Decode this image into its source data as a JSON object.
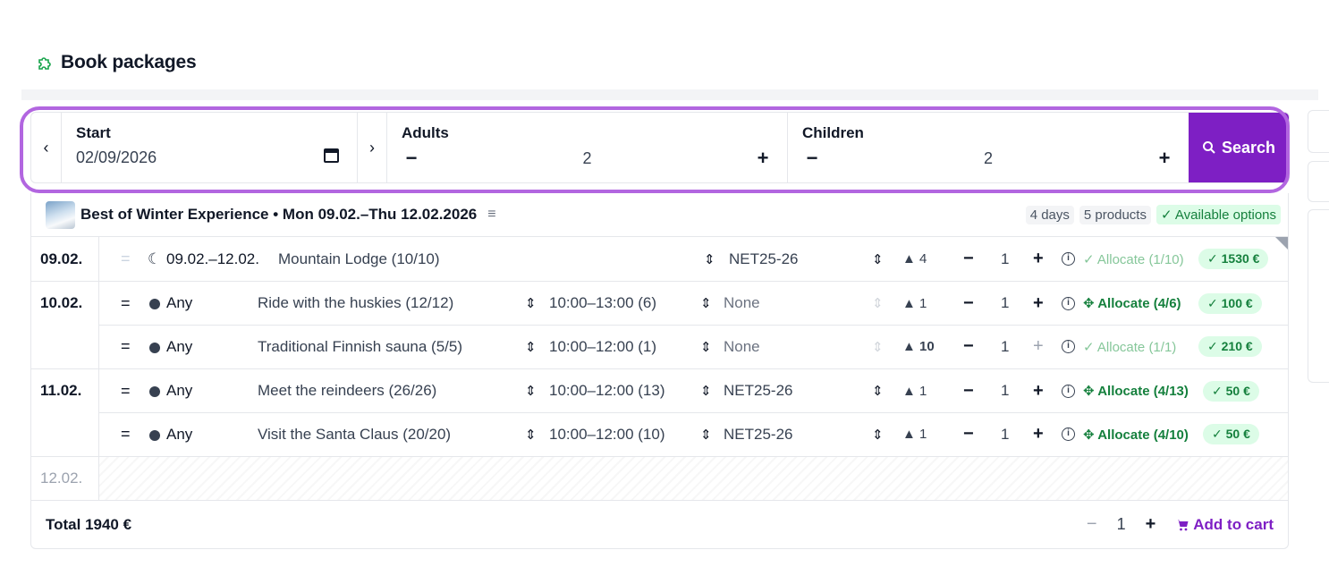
{
  "page": {
    "title": "Book packages",
    "icon": "puzzle-piece-icon"
  },
  "search": {
    "prev_label": "‹",
    "next_label": "›",
    "start": {
      "label": "Start",
      "value": "02/09/2026"
    },
    "adults": {
      "label": "Adults",
      "value": "2",
      "minus": "−",
      "plus": "+"
    },
    "children": {
      "label": "Children",
      "value": "2",
      "minus": "−",
      "plus": "+"
    },
    "button_label": "Search"
  },
  "package": {
    "title": "Best of Winter Experience • Mon 09.02.–Thu 12.02.2026",
    "days": "4 days",
    "products": "5 products",
    "available": "✓ Available options"
  },
  "days": [
    {
      "date": "09.02."
    },
    {
      "date": "10.02."
    },
    {
      "date": "11.02."
    },
    {
      "date": "12.02."
    }
  ],
  "items": [
    {
      "drag": "=",
      "time": "09.02.–12.02.",
      "name": "Mountain Lodge (10/10)",
      "slot": "",
      "option": "NET25-26",
      "persons": "4",
      "qty": "1",
      "allocate": "✓ Allocate (1/10)",
      "price": "✓ 1530 €"
    },
    {
      "drag": "=",
      "time": "Any",
      "name": "Ride with the huskies (12/12)",
      "slot": "10:00–13:00 (6)",
      "option": "None",
      "persons": "1",
      "qty": "1",
      "allocate": "Allocate (4/6)",
      "price": "✓ 100 €"
    },
    {
      "drag": "=",
      "time": "Any",
      "name": "Traditional Finnish sauna (5/5)",
      "slot": "10:00–12:00 (1)",
      "option": "None",
      "persons": "10",
      "qty": "1",
      "allocate": "✓ Allocate (1/1)",
      "price": "✓ 210 €"
    },
    {
      "drag": "=",
      "time": "Any",
      "name": "Meet the reindeers (26/26)",
      "slot": "10:00–12:00 (13)",
      "option": "NET25-26",
      "persons": "1",
      "qty": "1",
      "allocate": "Allocate (4/13)",
      "price": "✓ 50 €"
    },
    {
      "drag": "=",
      "time": "Any",
      "name": "Visit the Santa Claus (20/20)",
      "slot": "10:00–12:00 (10)",
      "option": "NET25-26",
      "persons": "1",
      "qty": "1",
      "allocate": "Allocate (4/10)",
      "price": "✓ 50 €"
    }
  ],
  "controls": {
    "minus": "−",
    "plus": "+",
    "info": "i",
    "updown": "⌃⌄"
  },
  "footer": {
    "total": "Total 1940 €",
    "minus": "−",
    "qty": "1",
    "plus": "+",
    "add_to_cart": "Add to cart"
  },
  "colors": {
    "accent": "#7e1fc4",
    "highlight": "#b266e0",
    "success": "#15803d",
    "success_bg": "#dcfce7"
  }
}
